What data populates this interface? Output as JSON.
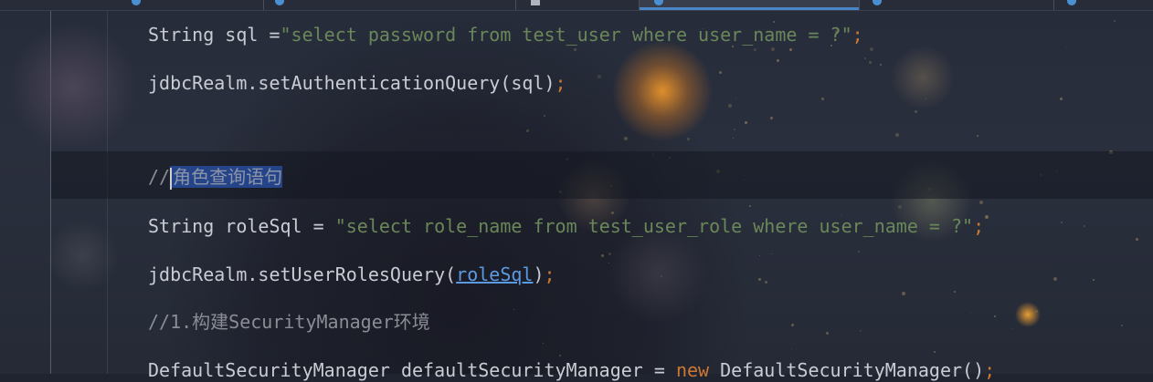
{
  "tabs": [
    {
      "icon": "java-class-icon",
      "label": ""
    },
    {
      "icon": "java-class-icon",
      "label": ""
    },
    {
      "icon": "file-icon",
      "label": ""
    },
    {
      "icon": "java-class-icon",
      "label": "",
      "active": true
    },
    {
      "icon": "java-class-icon",
      "label": ""
    },
    {
      "icon": "java-class-icon",
      "label": ""
    }
  ],
  "editor": {
    "line1": {
      "plain": "String sql =",
      "string": "\"select password from test_user where user_name = ?\"",
      "semi": ";"
    },
    "line2": {
      "plain": "jdbcRealm.setAuthenticationQuery(sql)",
      "semi": ";"
    },
    "line3": {
      "comment_prefix": "//",
      "comment_text": "角色查询语句"
    },
    "line4": {
      "plain": "String roleSql = ",
      "string": "\"select role_name from test_user_role where user_name = ?\"",
      "semi": ";"
    },
    "line5": {
      "plain": "jdbcRealm.setUserRolesQuery(",
      "link": "roleSql",
      "close": ")",
      "semi": ";"
    },
    "line6": {
      "comment": "//1.构建SecurityManager环境"
    },
    "line7": {
      "plain": "DefaultSecurityManager defaultSecurityManager = ",
      "keyword": "new",
      "rest": " DefaultSecurityManager()",
      "semi": ";"
    }
  },
  "colors": {
    "string": "#6a8759",
    "keyword": "#cc7832",
    "comment": "#8a8d94",
    "selection": "#2850aa",
    "active_tab_underline": "#4a86c7"
  }
}
